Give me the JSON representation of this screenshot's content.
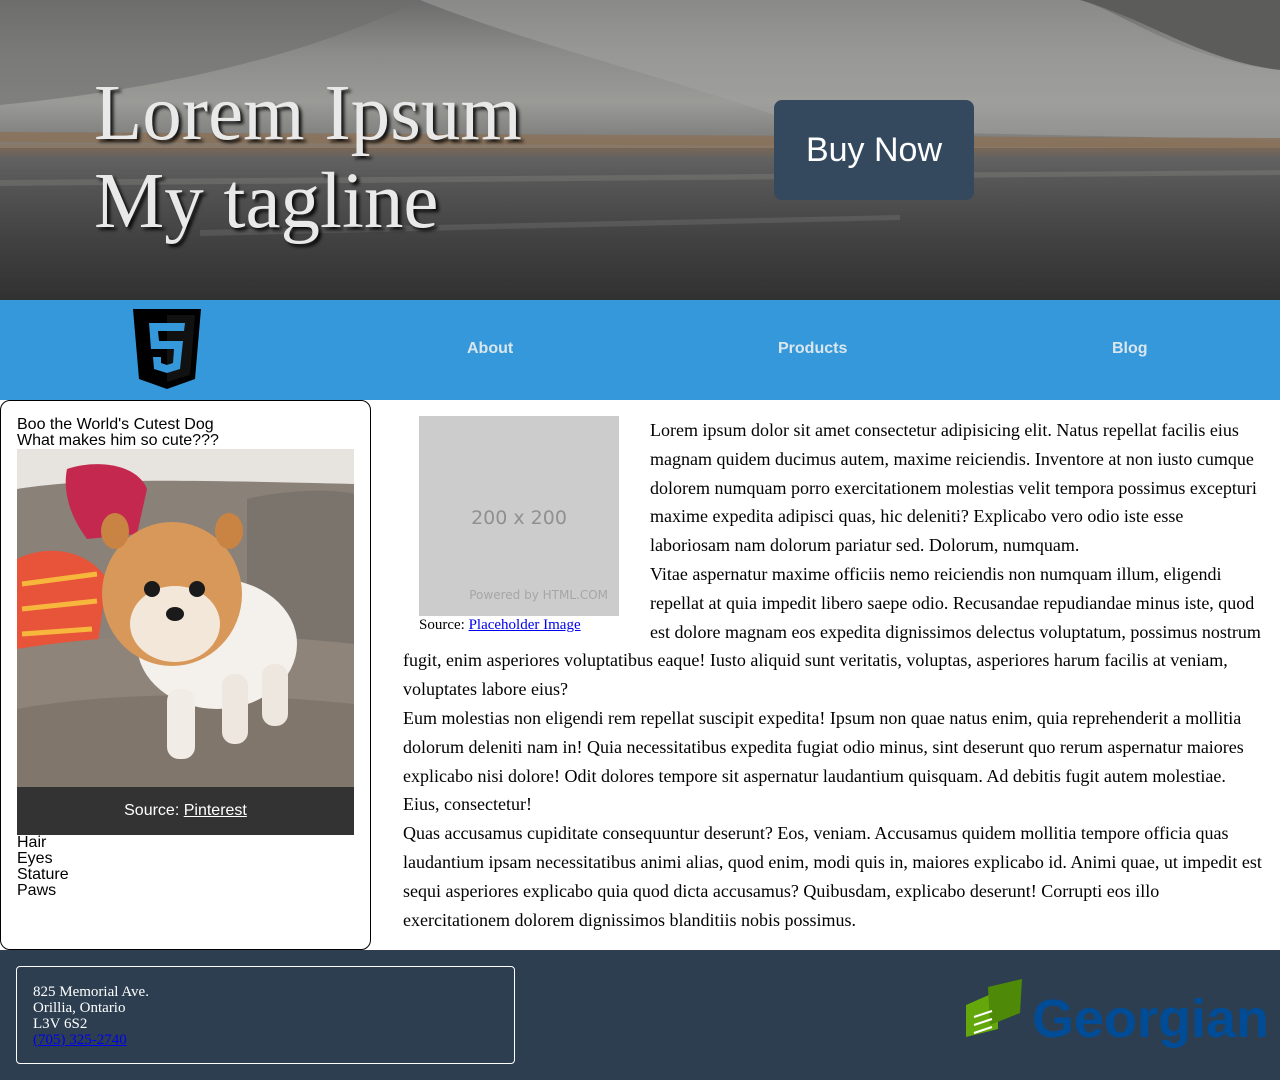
{
  "hero": {
    "title_line1": "Lorem Ipsum",
    "title_line2": "My tagline",
    "buy_button": "Buy Now"
  },
  "nav": {
    "logo_icon": "html5-shield-icon",
    "links": [
      "About",
      "Products",
      "Blog"
    ]
  },
  "aside": {
    "heading": "Boo the World's Cutest Dog",
    "subheading": "What makes him so cute???",
    "image_icon": "pomeranian-dog-photo",
    "caption_prefix": "Source: ",
    "caption_link": "Pinterest",
    "features": [
      "Hair",
      "Eyes",
      "Stature",
      "Paws"
    ]
  },
  "article": {
    "placeholder_size": "200 x 200",
    "placeholder_powered": "Powered by HTML.COM",
    "figcaption_prefix": "Source: ",
    "figcaption_link": "Placeholder Image",
    "paragraphs": [
      "Lorem ipsum dolor sit amet consectetur adipisicing elit. Natus repellat facilis eius magnam quidem ducimus autem, maxime reiciendis. Inventore at non iusto cumque dolorem numquam porro exercitationem molestias velit tempora possimus excepturi maxime expedita adipisci quas, hic deleniti? Explicabo vero odio iste esse laboriosam nam dolorum pariatur sed. Dolorum, numquam.",
      "Vitae aspernatur maxime officiis nemo reiciendis non numquam illum, eligendi repellat at quia impedit libero saepe odio. Recusandae repudiandae minus iste, quod est dolore magnam eos expedita dignissimos delectus voluptatum, possimus nostrum fugit, enim asperiores voluptatibus eaque! Iusto aliquid sunt veritatis, voluptas, asperiores harum facilis at veniam, voluptates labore eius?",
      "Eum molestias non eligendi rem repellat suscipit expedita! Ipsum non quae natus enim, quia reprehenderit a mollitia dolorum deleniti nam in! Quia necessitatibus expedita fugiat odio minus, sint deserunt quo rerum aspernatur maiores explicabo nisi dolore! Odit dolores tempore sit aspernatur laudantium quisquam. Ad debitis fugit autem molestiae. Eius, consectetur!",
      "Quas accusamus cupiditate consequuntur deserunt? Eos, veniam. Accusamus quidem mollitia tempore officia quas laudantium ipsam necessitatibus animi alias, quod enim, modi quis in, maiores explicabo id. Animi quae, ut impedit est sequi asperiores explicabo quia quod dicta accusamus? Quibusdam, explicabo deserunt! Corrupti eos illo exercitationem dolorem dignissimos blanditiis nobis possimus."
    ]
  },
  "footer": {
    "address_line1": "825 Memorial Ave.",
    "address_line2": "Orillia, Ontario",
    "address_line3": "L3V 6S2",
    "phone": "(705) 325-2740",
    "logo_text": "Georgian",
    "logo_icon": "georgian-college-logo"
  },
  "colors": {
    "nav_bg": "#3498db",
    "button_bg": "#34495e",
    "footer_bg": "#2c3e50",
    "caption_bg": "#333333",
    "georgian_blue": "#004c97",
    "georgian_green": "#64a70b"
  }
}
